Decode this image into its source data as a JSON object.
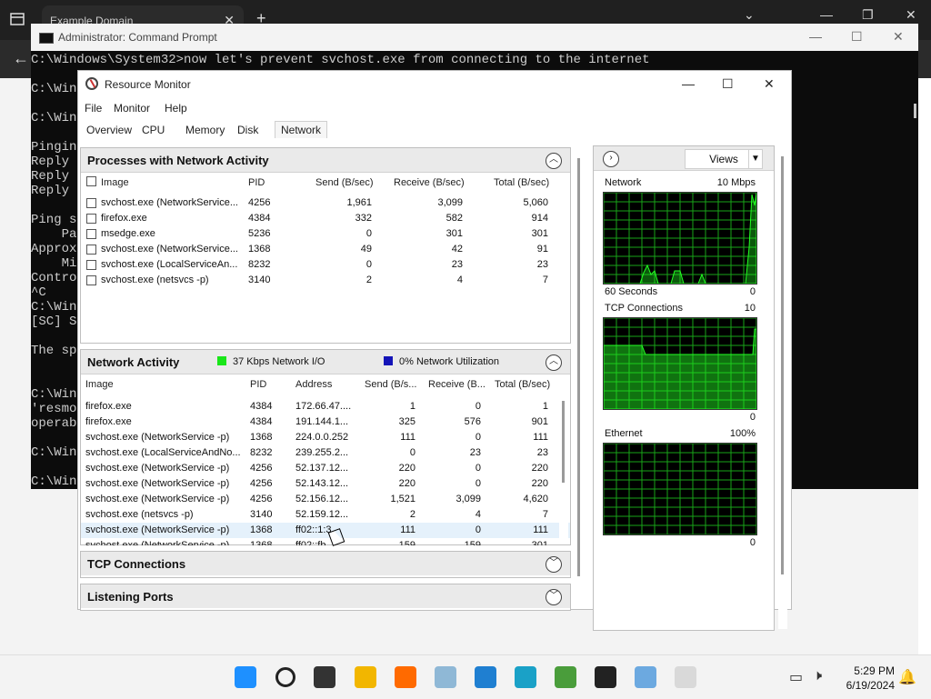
{
  "browser": {
    "tab_title": "Example Domain",
    "close_glyph": "✕",
    "new_tab_glyph": "+",
    "back_glyph": "←"
  },
  "cmd": {
    "title": "Administrator: Command Prompt",
    "lines": [
      "C:\\Windows\\System32>now let's prevent svchost.exe from connecting to the internet",
      "",
      "C:\\Wind",
      "",
      "C:\\Wind",
      "",
      "Pinging",
      "Reply f",
      "Reply f",
      "Reply f",
      "",
      "Ping st",
      "    Pac",
      "Approxi",
      "    Min",
      "Control",
      "^C",
      "C:\\Wind",
      "[SC] St",
      "",
      "The spe",
      "",
      "",
      "C:\\Wind",
      "'resmoo",
      "operabl",
      "",
      "C:\\Wind",
      "",
      "C:\\Wind"
    ]
  },
  "rm": {
    "title": "Resource Monitor",
    "menu": [
      "File",
      "Monitor",
      "Help"
    ],
    "tabs": [
      "Overview",
      "CPU",
      "Memory",
      "Disk",
      "Network"
    ],
    "active_tab": "Network",
    "processes": {
      "title": "Processes with Network Activity",
      "columns": [
        "Image",
        "PID",
        "Send (B/sec)",
        "Receive (B/sec)",
        "Total (B/sec)"
      ],
      "rows": [
        [
          "svchost.exe (NetworkService...",
          "4256",
          "1,961",
          "3,099",
          "5,060"
        ],
        [
          "firefox.exe",
          "4384",
          "332",
          "582",
          "914"
        ],
        [
          "msedge.exe",
          "5236",
          "0",
          "301",
          "301"
        ],
        [
          "svchost.exe (NetworkService...",
          "1368",
          "49",
          "42",
          "91"
        ],
        [
          "svchost.exe (LocalServiceAn...",
          "8232",
          "0",
          "23",
          "23"
        ],
        [
          "svchost.exe (netsvcs -p)",
          "3140",
          "2",
          "4",
          "7"
        ]
      ]
    },
    "network_activity": {
      "title": "Network Activity",
      "io_label": "37 Kbps Network I/O",
      "util_label": "0% Network Utilization",
      "io_color": "#19e619",
      "util_color": "#1414b8",
      "columns": [
        "Image",
        "PID",
        "Address",
        "Send (B/s...",
        "Receive (B...",
        "Total (B/sec)"
      ],
      "rows": [
        [
          "firefox.exe",
          "4384",
          "172.66.47....",
          "1",
          "0",
          "1"
        ],
        [
          "firefox.exe",
          "4384",
          "191.144.1...",
          "325",
          "576",
          "901"
        ],
        [
          "svchost.exe (NetworkService -p)",
          "1368",
          "224.0.0.252",
          "111",
          "0",
          "111"
        ],
        [
          "svchost.exe (LocalServiceAndNo...",
          "8232",
          "239.255.2...",
          "0",
          "23",
          "23"
        ],
        [
          "svchost.exe (NetworkService -p)",
          "4256",
          "52.137.12...",
          "220",
          "0",
          "220"
        ],
        [
          "svchost.exe (NetworkService -p)",
          "4256",
          "52.143.12...",
          "220",
          "0",
          "220"
        ],
        [
          "svchost.exe (NetworkService -p)",
          "4256",
          "52.156.12...",
          "1,521",
          "3,099",
          "4,620"
        ],
        [
          "svchost.exe (netsvcs -p)",
          "3140",
          "52.159.12...",
          "2",
          "4",
          "7"
        ],
        [
          "svchost.exe (NetworkService -p)",
          "1368",
          "ff02::1:3",
          "111",
          "0",
          "111"
        ],
        [
          "svchost.exe (NetworkService -p)",
          "1368",
          "ff02::fb",
          "159",
          "159",
          "301"
        ]
      ]
    },
    "tcp": {
      "title": "TCP Connections"
    },
    "listening": {
      "title": "Listening Ports"
    },
    "graphs": {
      "views_label": "Views",
      "network": {
        "title": "Network",
        "max": "10 Mbps",
        "footer_left": "60 Seconds",
        "footer_right": "0"
      },
      "tcp": {
        "title": "TCP Connections",
        "max": "10",
        "footer_right": "0"
      },
      "ethernet": {
        "title": "Ethernet",
        "max": "100%",
        "footer_right": "0"
      },
      "grid_color": "#19a319",
      "line_color": "#23ff23"
    }
  },
  "taskbar": {
    "time": "5:29 PM",
    "date": "6/19/2024",
    "apps": [
      "windows-icon",
      "search-icon",
      "task-view-icon",
      "file-explorer-icon",
      "firefox-icon",
      "app-icon",
      "vscode-icon",
      "edge-icon",
      "app2-icon",
      "terminal-icon",
      "control-panel-icon",
      "resource-monitor-icon"
    ]
  }
}
